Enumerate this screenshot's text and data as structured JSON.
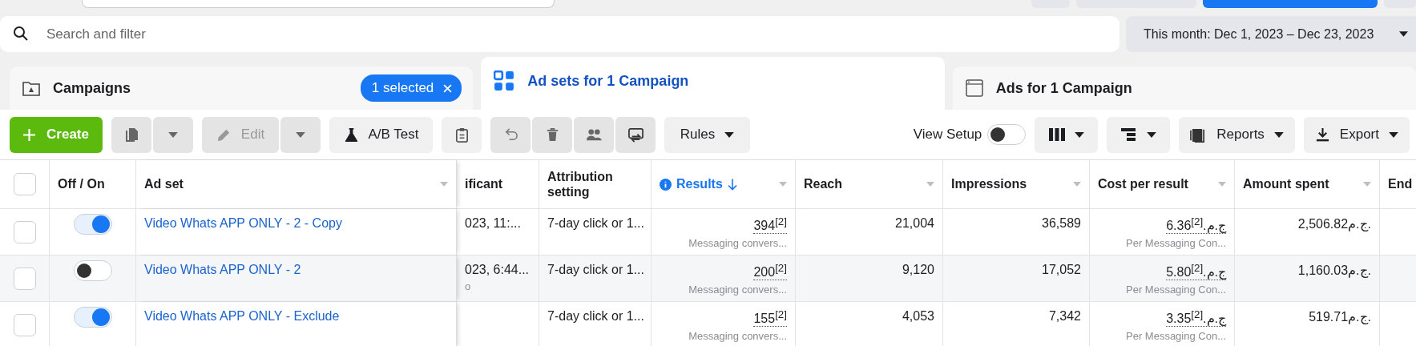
{
  "search": {
    "placeholder": "Search and filter"
  },
  "date_range": {
    "label": "This month: Dec 1, 2023 – Dec 23, 2023"
  },
  "tabs": [
    {
      "label": "Campaigns",
      "selected": false,
      "kind": "campaigns",
      "badge": "1 selected"
    },
    {
      "label": "Ad sets for 1 Campaign",
      "selected": true,
      "kind": "adsets"
    },
    {
      "label": "Ads for 1 Campaign",
      "selected": false,
      "kind": "ads"
    }
  ],
  "toolbar": {
    "create": "Create",
    "edit": {
      "label": "Edit",
      "disabled": true
    },
    "ab_test": "A/B Test",
    "rules": "Rules",
    "view_setup": {
      "label": "View Setup",
      "on": false
    },
    "reports": "Reports",
    "export": "Export"
  },
  "table": {
    "columns": [
      {
        "label": "Off / On",
        "sortable": false,
        "sorted": false
      },
      {
        "label": "Ad set",
        "sortable": true,
        "sorted": false
      },
      {
        "label": "ificant",
        "sortable": false,
        "sorted": false
      },
      {
        "label": "Attribution setting",
        "sortable": false,
        "sorted": false
      },
      {
        "label": "Results",
        "sortable": true,
        "sorted": true
      },
      {
        "label": "Reach",
        "sortable": true,
        "sorted": false
      },
      {
        "label": "Impressions",
        "sortable": true,
        "sorted": false
      },
      {
        "label": "Cost per result",
        "sortable": true,
        "sorted": false
      },
      {
        "label": "Amount spent",
        "sortable": true,
        "sorted": false
      },
      {
        "label": "End"
      }
    ],
    "all_checked": false,
    "rows": [
      {
        "checked": false,
        "on": true,
        "ad_set": "Video Whats APP ONLY - 2 - Copy",
        "column_3": "023, 11:...",
        "attribution": "7-day click or 1...",
        "results": "394$^{[2]}$",
        "results_note": "Messaging convers...",
        "reach": "21,004",
        "impressions": "36,589",
        "cost": "6.36ج.م.$^{[2]}$",
        "cost_note": "Per Messaging Con...",
        "spent": "2,506.82ج.م."
      },
      {
        "checked": false,
        "on": false,
        "ad_set": "Video Whats APP ONLY - 2",
        "column_3": "023, 6:44...",
        "column_3_note": "o",
        "attribution": "7-day click or 1...",
        "results": "200$^{[2]}$",
        "results_note": "Messaging convers...",
        "reach": "9,120",
        "impressions": "17,052",
        "cost": "5.80ج.م.$^{[2]}$",
        "cost_note": "Per Messaging Con...",
        "spent": "1,160.03ج.م."
      },
      {
        "checked": false,
        "on": true,
        "ad_set": "Video Whats APP ONLY - Exclude",
        "attribution": "7-day click or 1...",
        "results": "155$^{[2]}$",
        "results_note": "Messaging convers...",
        "reach": "4,053",
        "impressions": "7,342",
        "cost": "3.35ج.م.$^{[2]}$",
        "cost_note": "Per Messaging Con...",
        "spent": "519.71ج.م."
      }
    ]
  }
}
